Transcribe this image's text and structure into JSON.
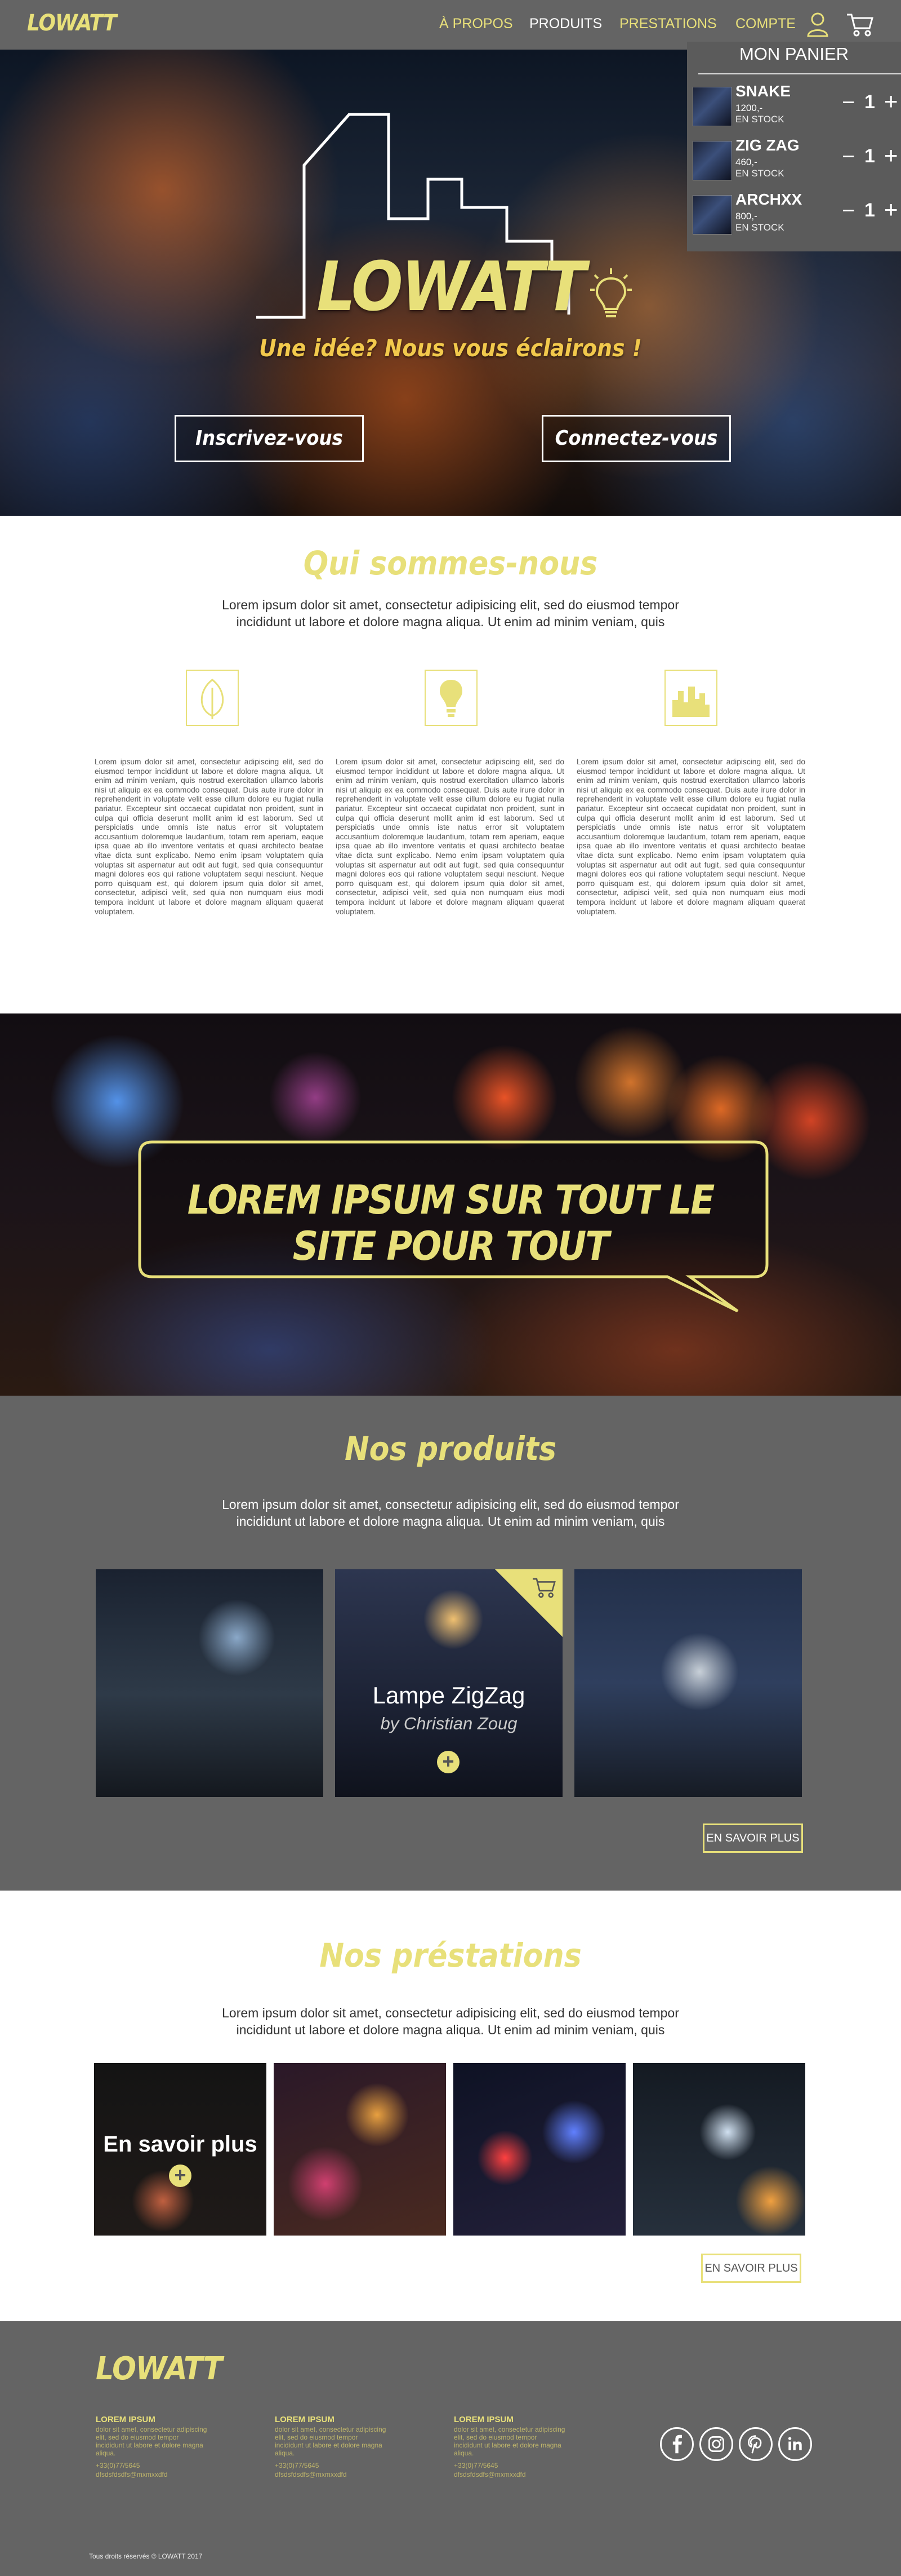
{
  "brand": {
    "logo": "LOWATT",
    "accent": "#e8e07a",
    "panel_gray": "#646464"
  },
  "nav": {
    "items": [
      {
        "label": "À PROPOS",
        "color": "#e8e07a"
      },
      {
        "label": "PRODUITS",
        "color": "#ffffff"
      },
      {
        "label": "PRESTATIONS",
        "color": "#e8e07a"
      },
      {
        "label": "COMPTE",
        "color": "#e8e07a"
      }
    ],
    "icons": [
      "user-icon",
      "cart-icon"
    ]
  },
  "cart": {
    "title": "MON PANIER",
    "minus": "−",
    "plus": "+",
    "items": [
      {
        "name": "SNAKE",
        "price": "1200,-",
        "stock": "EN STOCK",
        "qty": "1"
      },
      {
        "name": "ZIG ZAG",
        "price": "460,-",
        "stock": "EN STOCK",
        "qty": "1"
      },
      {
        "name": "ARCHXX",
        "price": "800,-",
        "stock": "EN STOCK",
        "qty": "1"
      }
    ]
  },
  "hero": {
    "title": "LOWATT",
    "tagline": "Une idée? Nous vous éclairons !",
    "signup_label": "Inscrivez-vous",
    "login_label": "Connectez-vous",
    "icons": [
      "skyline-outline",
      "lightbulb-icon"
    ]
  },
  "about": {
    "title": "Qui sommes-nous",
    "lead": "Lorem ipsum dolor sit amet, consectetur adipisicing elit, sed do eiusmod tempor incididunt ut labore et dolore magna aliqua. Ut enim ad minim veniam, quis",
    "features": [
      {
        "icon": "leaf-icon",
        "text": "Lorem ipsum dolor sit amet, consectetur adipiscing elit, sed do eiusmod tempor incididunt ut labore et dolore magna aliqua. Ut enim ad minim veniam, quis nostrud exercitation ullamco laboris nisi ut aliquip ex ea commodo consequat. Duis aute irure dolor in reprehenderit in voluptate velit esse cillum dolore eu fugiat nulla pariatur. Excepteur sint occaecat cupidatat non proident, sunt in culpa qui officia deserunt mollit anim id est laborum. Sed ut perspiciatis unde omnis iste natus error sit voluptatem accusantium doloremque laudantium, totam rem aperiam, eaque ipsa quae ab illo inventore veritatis et quasi architecto beatae vitae dicta sunt explicabo. Nemo enim ipsam voluptatem quia voluptas sit aspernatur aut odit aut fugit, sed quia consequuntur magni dolores eos qui ratione voluptatem sequi nesciunt. Neque porro quisquam est, qui dolorem ipsum quia dolor sit amet, consectetur, adipisci velit, sed quia non numquam eius modi tempora incidunt ut labore et dolore magnam aliquam quaerat voluptatem."
      },
      {
        "icon": "lightbulb-icon",
        "text": "Lorem ipsum dolor sit amet, consectetur adipiscing elit, sed do eiusmod tempor incididunt ut labore et dolore magna aliqua. Ut enim ad minim veniam, quis nostrud exercitation ullamco laboris nisi ut aliquip ex ea commodo consequat. Duis aute irure dolor in reprehenderit in voluptate velit esse cillum dolore eu fugiat nulla pariatur. Excepteur sint occaecat cupidatat non proident, sunt in culpa qui officia deserunt mollit anim id est laborum. Sed ut perspiciatis unde omnis iste natus error sit voluptatem accusantium doloremque laudantium, totam rem aperiam, eaque ipsa quae ab illo inventore veritatis et quasi architecto beatae vitae dicta sunt explicabo. Nemo enim ipsam voluptatem quia voluptas sit aspernatur aut odit aut fugit, sed quia consequuntur magni dolores eos qui ratione voluptatem sequi nesciunt. Neque porro quisquam est, qui dolorem ipsum quia dolor sit amet, consectetur, adipisci velit, sed quia non numquam eius modi tempora incidunt ut labore et dolore magnam aliquam quaerat voluptatem."
      },
      {
        "icon": "city-icon",
        "text": "Lorem ipsum dolor sit amet, consectetur adipiscing elit, sed do eiusmod tempor incididunt ut labore et dolore magna aliqua. Ut enim ad minim veniam, quis nostrud exercitation ullamco laboris nisi ut aliquip ex ea commodo consequat. Duis aute irure dolor in reprehenderit in voluptate velit esse cillum dolore eu fugiat nulla pariatur. Excepteur sint occaecat cupidatat non proident, sunt in culpa qui officia deserunt mollit anim id est laborum. Sed ut perspiciatis unde omnis iste natus error sit voluptatem accusantium doloremque laudantium, totam rem aperiam, eaque ipsa quae ab illo inventore veritatis et quasi architecto beatae vitae dicta sunt explicabo. Nemo enim ipsam voluptatem quia voluptas sit aspernatur aut odit aut fugit, sed quia consequuntur magni dolores eos qui ratione voluptatem sequi nesciunt. Neque porro quisquam est, qui dolorem ipsum quia dolor sit amet, consectetur, adipisci velit, sed quia non numquam eius modi tempora incidunt ut labore et dolore magnam aliquam quaerat voluptatem."
      }
    ]
  },
  "promo": {
    "text": "LOREM IPSUM SUR TOUT LE SITE POUR TOUT"
  },
  "products": {
    "title": "Nos produits",
    "lead": "Lorem ipsum dolor sit amet, consectetur adipisicing elit, sed do eiusmod tempor incididunt ut labore et dolore magna aliqua. Ut enim ad minim veniam, quis",
    "featured_name": "Lampe ZigZag",
    "featured_by": "by Christian Zoug",
    "more_label": "EN SAVOIR PLUS"
  },
  "services": {
    "title": "Nos préstations",
    "lead": "Lorem ipsum dolor sit amet, consectetur adipisicing elit, sed do eiusmod tempor incididunt ut labore et dolore magna aliqua. Ut enim ad minim veniam, quis",
    "overlay_label": "En savoir plus",
    "more_label": "EN SAVOIR PLUS"
  },
  "footer": {
    "logo": "LOWATT",
    "columns": [
      {
        "title": "LOREM IPSUM",
        "body": "dolor sit amet, consectetur adipiscing elit, sed do eiusmod tempor incididunt ut labore et dolore magna aliqua.",
        "phone": "+33(0)77/5645",
        "email": "dfsdsfdsdfs@mxmxxdfd"
      },
      {
        "title": "LOREM IPSUM",
        "body": "dolor sit amet, consectetur adipiscing elit, sed do eiusmod tempor incididunt ut labore et dolore magna aliqua.",
        "phone": "+33(0)77/5645",
        "email": "dfsdsfdsdfs@mxmxxdfd"
      },
      {
        "title": "LOREM IPSUM",
        "body": "dolor sit amet, consectetur adipiscing elit, sed do eiusmod tempor incididunt ut labore et dolore magna aliqua.",
        "phone": "+33(0)77/5645",
        "email": "dfsdsfdsdfs@mxmxxdfd"
      }
    ],
    "social": [
      "facebook-icon",
      "instagram-icon",
      "pinterest-icon",
      "linkedin-icon"
    ],
    "copyright": "Tous droits réservés © LOWATT 2017"
  }
}
